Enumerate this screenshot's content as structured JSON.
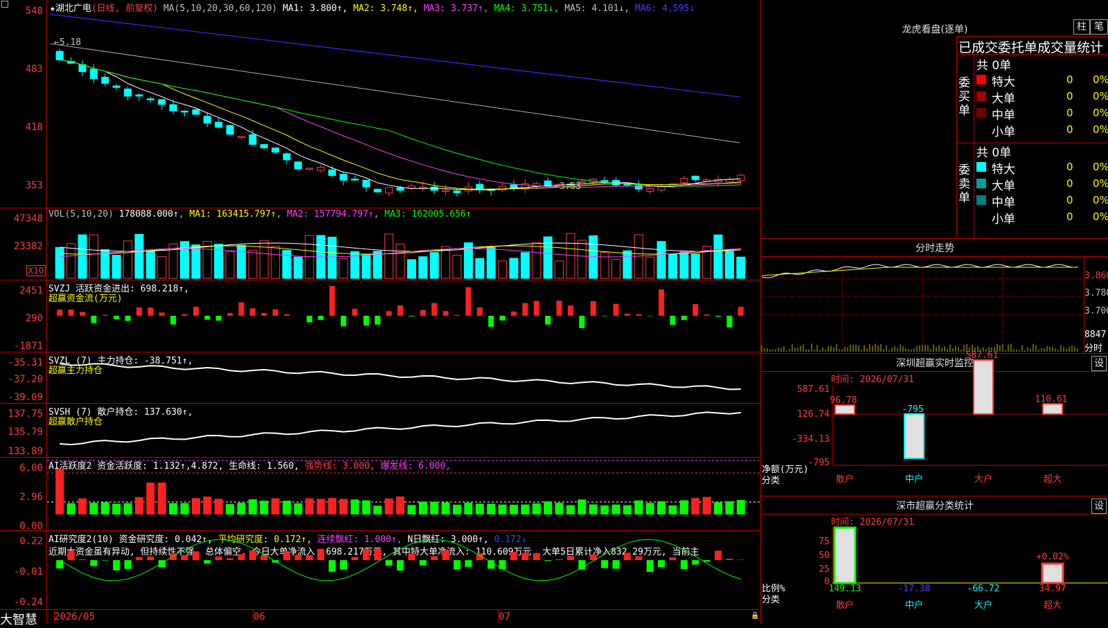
{
  "main": {
    "star": "★",
    "stock_name": "湖北广电",
    "period_label": "(日线, 前复权)",
    "ma_label": "MA(5,10,20,30,60,120)",
    "ma_values": [
      {
        "text": "MA1: 3.800↑",
        "color": "#ffffff"
      },
      {
        "text": "MA2: 3.748↑",
        "color": "#ffff00"
      },
      {
        "text": "MA3: 3.737↑",
        "color": "#ff40ff"
      },
      {
        "text": "MA4: 3.751↓",
        "color": "#00ff00"
      },
      {
        "text": "MA5: 4.101↓",
        "color": "#c0c0c0"
      },
      {
        "text": "MA6: 4.595↓",
        "color": "#4040ff"
      }
    ],
    "y_ticks": [
      "548",
      "483",
      "418",
      "353"
    ],
    "high_mark": "5.18",
    "low_mark": "3.53"
  },
  "vol": {
    "label": "VOL(5,10,20)",
    "value": "178088.000↑",
    "ma1": "MA1: 163415.797↑",
    "ma2": "MA2: 157794.797↑",
    "ma3": "MA3: 162005.656↑",
    "y_ticks": [
      "47348",
      "23382"
    ],
    "unit": "X10"
  },
  "svzj": {
    "label": "SVZJ  活跃资金进出: 698.218↑,",
    "sub": "超赢资金流(万元)",
    "y_ticks": [
      "2451",
      "290",
      "-1871"
    ]
  },
  "svzl": {
    "label": "SVZL (7) 主力持仓: -38.751↑,",
    "sub": "超赢主力持仓",
    "y_ticks": [
      "-35.31",
      "-37.20",
      "-39.09"
    ]
  },
  "svsh": {
    "label": "SVSH (7) 散户持仓: 137.630↑,",
    "sub": "超赢散户持仓",
    "y_ticks": [
      "137.75",
      "135.79",
      "133.89"
    ]
  },
  "ai1": {
    "label": "AI活跃度2 资金活跃度: 1.132↑,4.872,",
    "life": "生命线: 1.560,",
    "strong": "强势线: 3.000,",
    "burst": "爆发线: 6.000,",
    "y_ticks": [
      "6.00",
      "2.96",
      "0.00"
    ]
  },
  "ai2": {
    "label": "AI研究度2(10) 资金研究度: 0.042↑,",
    "avg": "平均研究度: 0.172↑,",
    "cont": "连续飘红: 1.000↑,",
    "nday": "N日飘红: 3.000↑,",
    "val": "0.172↓",
    "commentary": "近期大资金虽有异动, 但持续性不强, 总体偏空, 今日大单净流入: 698.217万元, 其中特大单净流入: 110.609万元, 大单5日累计净入832.29万元, 当前主",
    "y_ticks": [
      "0.22",
      "-0.01",
      "-0.24"
    ]
  },
  "bottom": {
    "brand": "大智慧",
    "dates": [
      "2026/05",
      "06",
      "07"
    ]
  },
  "right": {
    "lhb_title": "龙虎看盘(逐单)",
    "btn_bar": "柱",
    "btn_pen": "笔",
    "tabs": "已成交委托单成交量统计",
    "buy_side": "委买单",
    "sell_side": "委卖单",
    "buy_total": "共 0单",
    "sell_total": "共 0单",
    "buy_rows": [
      {
        "name": "特大",
        "count": "0",
        "pct": "0%",
        "color": "#ff0000"
      },
      {
        "name": "大单",
        "count": "0",
        "pct": "0%",
        "color": "#a00000"
      },
      {
        "name": "中单",
        "count": "0",
        "pct": "0%",
        "color": "#700000"
      },
      {
        "name": "小单",
        "count": "0",
        "pct": "0%",
        "color": "#000000"
      }
    ],
    "sell_rows": [
      {
        "name": "特大",
        "count": "0",
        "pct": "0%",
        "color": "#00ffff"
      },
      {
        "name": "大单",
        "count": "0",
        "pct": "0%",
        "color": "#00a0a0"
      },
      {
        "name": "中单",
        "count": "0",
        "pct": "0%",
        "color": "#008080"
      },
      {
        "name": "小单",
        "count": "0",
        "pct": "0%",
        "color": "#000000"
      }
    ],
    "intraday_title": "分时走势",
    "intraday_ticks": [
      "3.860",
      "3.780",
      "3.700"
    ],
    "intraday_vol": "8847",
    "intraday_vol_unit": "分时",
    "sz_title": "深圳超赢实时监控",
    "sz_btn": "设",
    "sz_time": "时间: 2026/07/31",
    "sz_ylabels": [
      "587.61",
      "126.74",
      "-334.13",
      "-795"
    ],
    "sz_axis_name": "净额(万元)",
    "sz_axis_cat": "分类",
    "sz_categories": [
      "散户",
      "中户",
      "大户",
      "超大"
    ],
    "sz_values": [
      "96.78",
      "-795",
      "587.61",
      "110.61"
    ],
    "cls_title": "深市超赢分类统计",
    "cls_btn": "设",
    "cls_time": "时间: 2026/07/31",
    "cls_ylabels": [
      "75",
      "50",
      "25",
      "0"
    ],
    "cls_axis_name": "比例%",
    "cls_axis_cat": "分类",
    "cls_categories": [
      "散户",
      "中户",
      "大户",
      "超大"
    ],
    "cls_values": [
      "149.13",
      "-17.38",
      "-66.72",
      "34.97"
    ],
    "cls_top_label": "+0.02%"
  },
  "chart_data": [
    {
      "type": "line",
      "title": "湖北广电 (日线, 前复权)",
      "x": [
        "2026/05",
        "06",
        "07"
      ],
      "series": [
        {
          "name": "MA1",
          "values": [
            3.8
          ]
        },
        {
          "name": "MA2",
          "values": [
            3.748
          ]
        },
        {
          "name": "MA3",
          "values": [
            3.737
          ]
        },
        {
          "name": "MA4",
          "values": [
            3.751
          ]
        },
        {
          "name": "MA5",
          "values": [
            4.101
          ]
        },
        {
          "name": "MA6",
          "values": [
            4.595
          ]
        }
      ],
      "ylim": [
        3.53,
        5.48
      ],
      "annotations": [
        "5.18",
        "3.53"
      ]
    },
    {
      "type": "bar",
      "title": "超赢实时监控",
      "categories": [
        "散户",
        "中户",
        "大户",
        "超大"
      ],
      "values": [
        96.78,
        -795,
        587.61,
        110.61
      ],
      "ylabel": "净额(万元)",
      "ylim": [
        -795,
        587.61
      ]
    },
    {
      "type": "bar",
      "title": "深市超赢分类统计",
      "categories": [
        "散户",
        "中户",
        "大户",
        "超大"
      ],
      "values": [
        149.13,
        -17.38,
        -66.72,
        34.97
      ],
      "ylabel": "比例%",
      "ylim": [
        0,
        75
      ]
    }
  ]
}
